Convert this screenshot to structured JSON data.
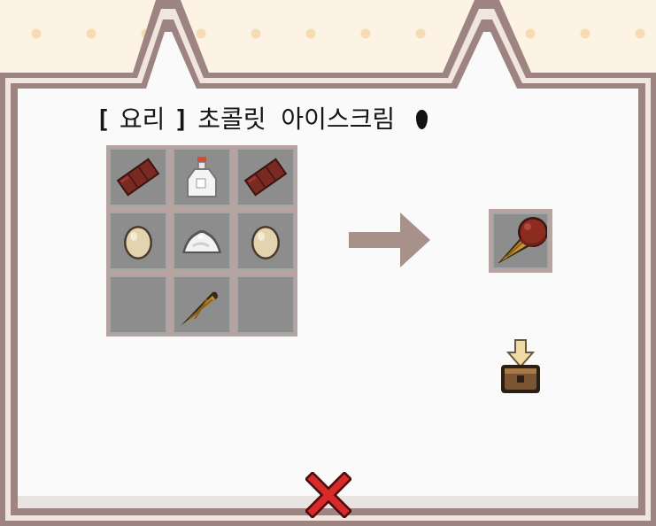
{
  "recipe": {
    "bracket_open": "[",
    "category": "요리",
    "bracket_close": "]",
    "name": "초콜릿 아이스크림",
    "drop_icon": "ink-drop-icon"
  },
  "ingredients": [
    "chocolate-bar-icon",
    "milk-bottle-icon",
    "chocolate-bar-icon",
    "egg-icon",
    "sugar-pile-icon",
    "egg-icon",
    "",
    "waffle-cone-icon",
    ""
  ],
  "result": "chocolate-ice-cream-icon",
  "station": "cooking-pot-icon",
  "close": "close-icon",
  "colors": {
    "background": "#fdf3e4",
    "frame": "#9d8480",
    "panel": "#f5f5f5",
    "slot": "#8d8d8d",
    "arrow": "#a8908b",
    "close": "#d92a2a"
  }
}
